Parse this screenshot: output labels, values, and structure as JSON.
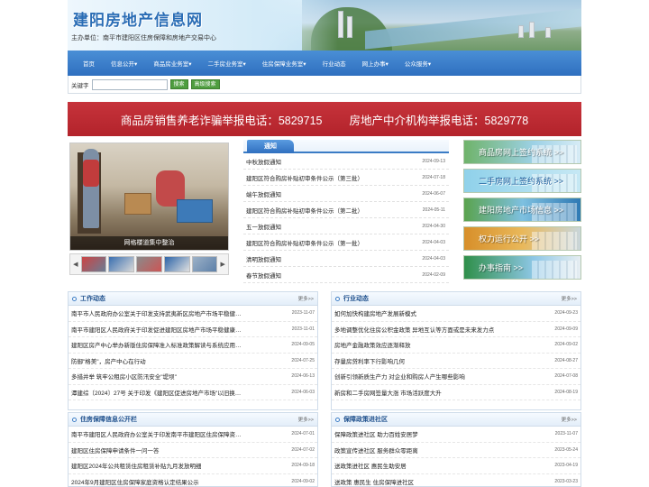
{
  "header": {
    "site_title": "建阳房地产信息网",
    "sponsor": "主办单位：南平市建阳区住房保障和房地产交易中心"
  },
  "nav": {
    "items": [
      "首页",
      "信息公开▾",
      "商品房业务室▾",
      "二手房业务室▾",
      "住房保障业务室▾",
      "行业动态",
      "网上办事▾",
      "公众服务▾"
    ]
  },
  "search": {
    "label": "关键字",
    "placeholder": "",
    "search_button": "搜索",
    "advanced_button": "高级搜索"
  },
  "report_banner": {
    "left": "商品房销售养老诈骗举报电话：5829715",
    "right": "房地产中介机构举报电话：5829778"
  },
  "slider": {
    "caption": "网格楼道集中整治"
  },
  "notice": {
    "tab": "通知",
    "items": [
      {
        "title": "中秋放假通知",
        "date": "2024-09-13"
      },
      {
        "title": "建阳区符合购房补贴初审条件公示（第三批）",
        "date": "2024-07-18"
      },
      {
        "title": "端午放假通知",
        "date": "2024-06-07"
      },
      {
        "title": "建阳区符合购房补贴初审条件公示（第二批）",
        "date": "2024-05-11"
      },
      {
        "title": "五一放假通知",
        "date": "2024-04-30"
      },
      {
        "title": "建阳区符合购房补贴初审条件公示（第一批）",
        "date": "2024-04-03"
      },
      {
        "title": "清明放假通知",
        "date": "2024-04-03"
      },
      {
        "title": "春节放假通知",
        "date": "2024-02-09"
      }
    ]
  },
  "side_links": [
    {
      "label": "商品房网上签约系统 >>"
    },
    {
      "label": "二手房网上签约系统 >>"
    },
    {
      "label": "建阳房地产市场信息 >>"
    },
    {
      "label": "权力运行公开 >>"
    },
    {
      "label": "办事指南 >>"
    }
  ],
  "panels": {
    "work": {
      "title": "工作动态",
      "more": "更多>>",
      "items": [
        {
          "title": "南平市人民政府办公室关于印发支持武夷新区房地产市场平稳健…",
          "date": "2023-11-07"
        },
        {
          "title": "南平市建阳区人民政府关于印发促进建阳区房地产市场平稳健康…",
          "date": "2023-11-01"
        },
        {
          "title": "建阳区房产中心举办新版住房保障准入标准政策解读与系统应用…",
          "date": "2024-09-05"
        },
        {
          "title": "防御\"格美\"，房产中心在行动",
          "date": "2024-07-25"
        },
        {
          "title": "多措并举 筑牢公租房小区防汛安全\"堤坝\"",
          "date": "2024-06-13"
        },
        {
          "title": "潭建综〔2024〕27号 关于印发《建阳区促进房地产市场\"以旧换…",
          "date": "2024-06-03"
        }
      ]
    },
    "industry": {
      "title": "行业动态",
      "more": "更多>>",
      "items": [
        {
          "title": "如何加快构建房地产发展新模式",
          "date": "2024-09-23"
        },
        {
          "title": "多地调整优化住房公积金政策 异地互认等方面或是未来发力点",
          "date": "2024-09-09"
        },
        {
          "title": "房地产金融政策效应逐渐释放",
          "date": "2024-09-02"
        },
        {
          "title": "存量房贷利率下行影响几何",
          "date": "2024-08-27"
        },
        {
          "title": "创新引领新质生产力 对企业和购房人产生哪些影响",
          "date": "2024-07-08"
        },
        {
          "title": "新房和二手房网签量大涨 市场活跃度大升",
          "date": "2024-08-19"
        }
      ]
    },
    "housing_info": {
      "title": "住房保障信息公开栏",
      "more": "更多>>",
      "items": [
        {
          "title": "南平市建阳区人民政府办公室关于印发南平市建阳区住房保障资…",
          "date": "2024-07-01"
        },
        {
          "title": "建阳区住房保障申请条件一问一答",
          "date": "2024-07-02"
        },
        {
          "title": "建阳区2024年公共租赁住房租赁补贴九月发放明细",
          "date": "2024-09-18"
        },
        {
          "title": "2024年9月建阳区住房保障家庭资格认定结果公示",
          "date": "2024-09-02"
        }
      ]
    },
    "housing_policy": {
      "title": "保障政策进社区",
      "more": "更多>>",
      "items": [
        {
          "title": "保障政策进社区 助力百姓安居梦",
          "date": "2023-11-07"
        },
        {
          "title": "政策宣传进社区 服务群众零距离",
          "date": "2023-05-24"
        },
        {
          "title": "送政策进社区 惠民生助安居",
          "date": "2023-04-19"
        },
        {
          "title": "送政策 惠民生 住房保障进社区",
          "date": "2023-03-23"
        }
      ]
    }
  },
  "colors": {
    "nav_blue": "#2f6fbf",
    "report_red": "#c6333b",
    "title_blue": "#2a6db5",
    "panel_title": "#1d4f8c"
  }
}
